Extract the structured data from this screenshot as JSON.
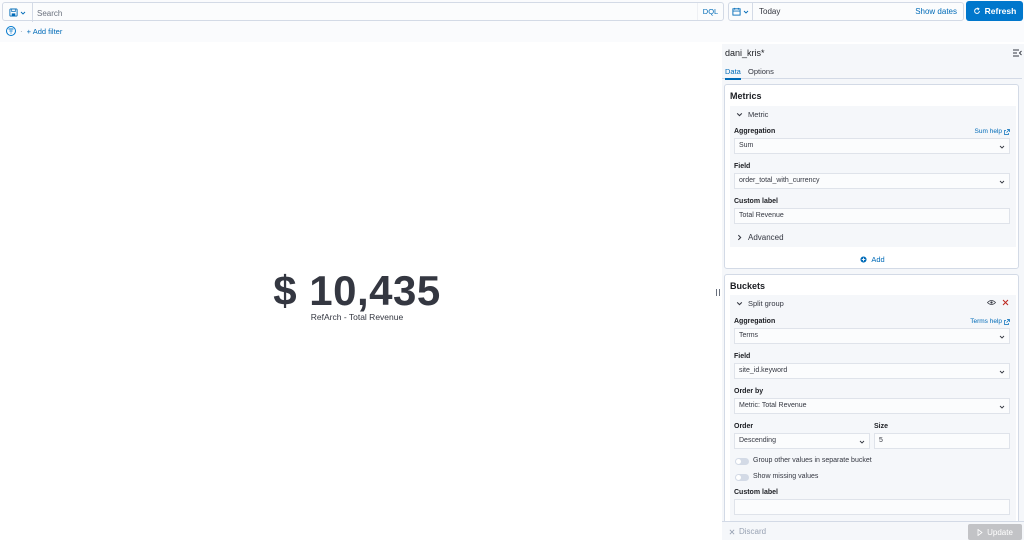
{
  "query_bar": {
    "search_placeholder": "Search",
    "language": "DQL",
    "date_value": "Today",
    "show_dates": "Show dates",
    "refresh_label": "Refresh"
  },
  "filters": {
    "add_filter": "+ Add filter"
  },
  "visualization": {
    "metric_value": "$ 10,435",
    "metric_label": "RefArch - Total Revenue"
  },
  "sidebar": {
    "title": "dani_kris*",
    "tabs": [
      {
        "label": "Data",
        "active": true
      },
      {
        "label": "Options",
        "active": false
      }
    ],
    "metrics": {
      "title": "Metrics",
      "item_title": "Metric",
      "aggregation_label": "Aggregation",
      "aggregation_help": "Sum help",
      "aggregation_value": "Sum",
      "field_label": "Field",
      "field_value": "order_total_with_currency",
      "custom_label_label": "Custom label",
      "custom_label_value": "Total Revenue",
      "advanced": "Advanced",
      "add": "Add"
    },
    "buckets": {
      "title": "Buckets",
      "item_title": "Split group",
      "aggregation_label": "Aggregation",
      "aggregation_help": "Terms help",
      "aggregation_value": "Terms",
      "field_label": "Field",
      "field_value": "site_id.keyword",
      "order_by_label": "Order by",
      "order_by_value": "Metric: Total Revenue",
      "order_label": "Order",
      "order_value": "Descending",
      "size_label": "Size",
      "size_value": "5",
      "group_other": "Group other values in separate bucket",
      "show_missing": "Show missing values",
      "custom_label_label": "Custom label",
      "custom_label_value": ""
    }
  },
  "footer": {
    "discard": "Discard",
    "update": "Update"
  },
  "colors": {
    "accent": "#0077cc",
    "link": "#006bb8",
    "text": "#343741",
    "danger": "#bd271e",
    "panel_bg": "#f5f7fa",
    "disabled_button": "#c2c3c6"
  }
}
